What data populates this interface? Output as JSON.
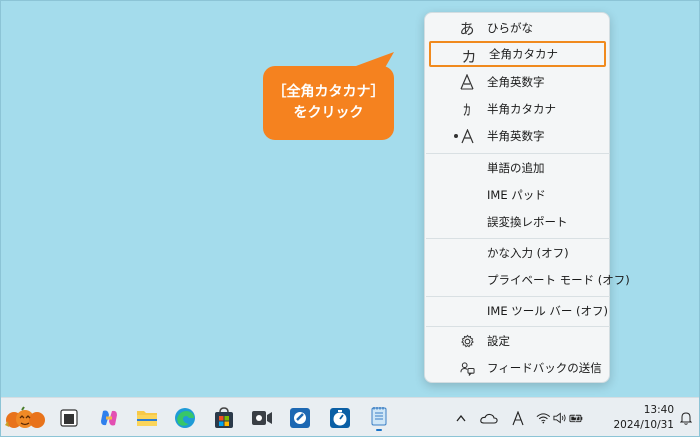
{
  "callout": {
    "line1": "［全角カタカナ］",
    "line2": "をクリック",
    "color": "#f5821f"
  },
  "ime_menu": {
    "modes": [
      {
        "icon": "あ",
        "label": "ひらがな",
        "selected": false,
        "highlighted": false
      },
      {
        "icon": "カ",
        "label": "全角カタカナ",
        "selected": false,
        "highlighted": true
      },
      {
        "icon": "A",
        "label": "全角英数字",
        "selected": false,
        "highlighted": false
      },
      {
        "icon": "ｶ",
        "label": "半角カタカナ",
        "selected": false,
        "highlighted": false
      },
      {
        "icon": "A",
        "label": "半角英数字",
        "selected": true,
        "highlighted": false
      }
    ],
    "tools": [
      "単語の追加",
      "IME パッド",
      "誤変換レポート"
    ],
    "input_options": [
      "かな入力 (オフ)",
      "プライベート モード (オフ)"
    ],
    "toolbar_option": "IME ツール バー (オフ)",
    "settings": [
      {
        "icon": "gear-icon",
        "label": "設定"
      },
      {
        "icon": "feedback-icon",
        "label": "フィードバックの送信"
      }
    ],
    "highlight_color": "#f08a1e"
  },
  "taskbar": {
    "tray": {
      "ime_indicator": "A"
    },
    "clock": {
      "time": "13:40",
      "date": "2024/10/31"
    }
  }
}
